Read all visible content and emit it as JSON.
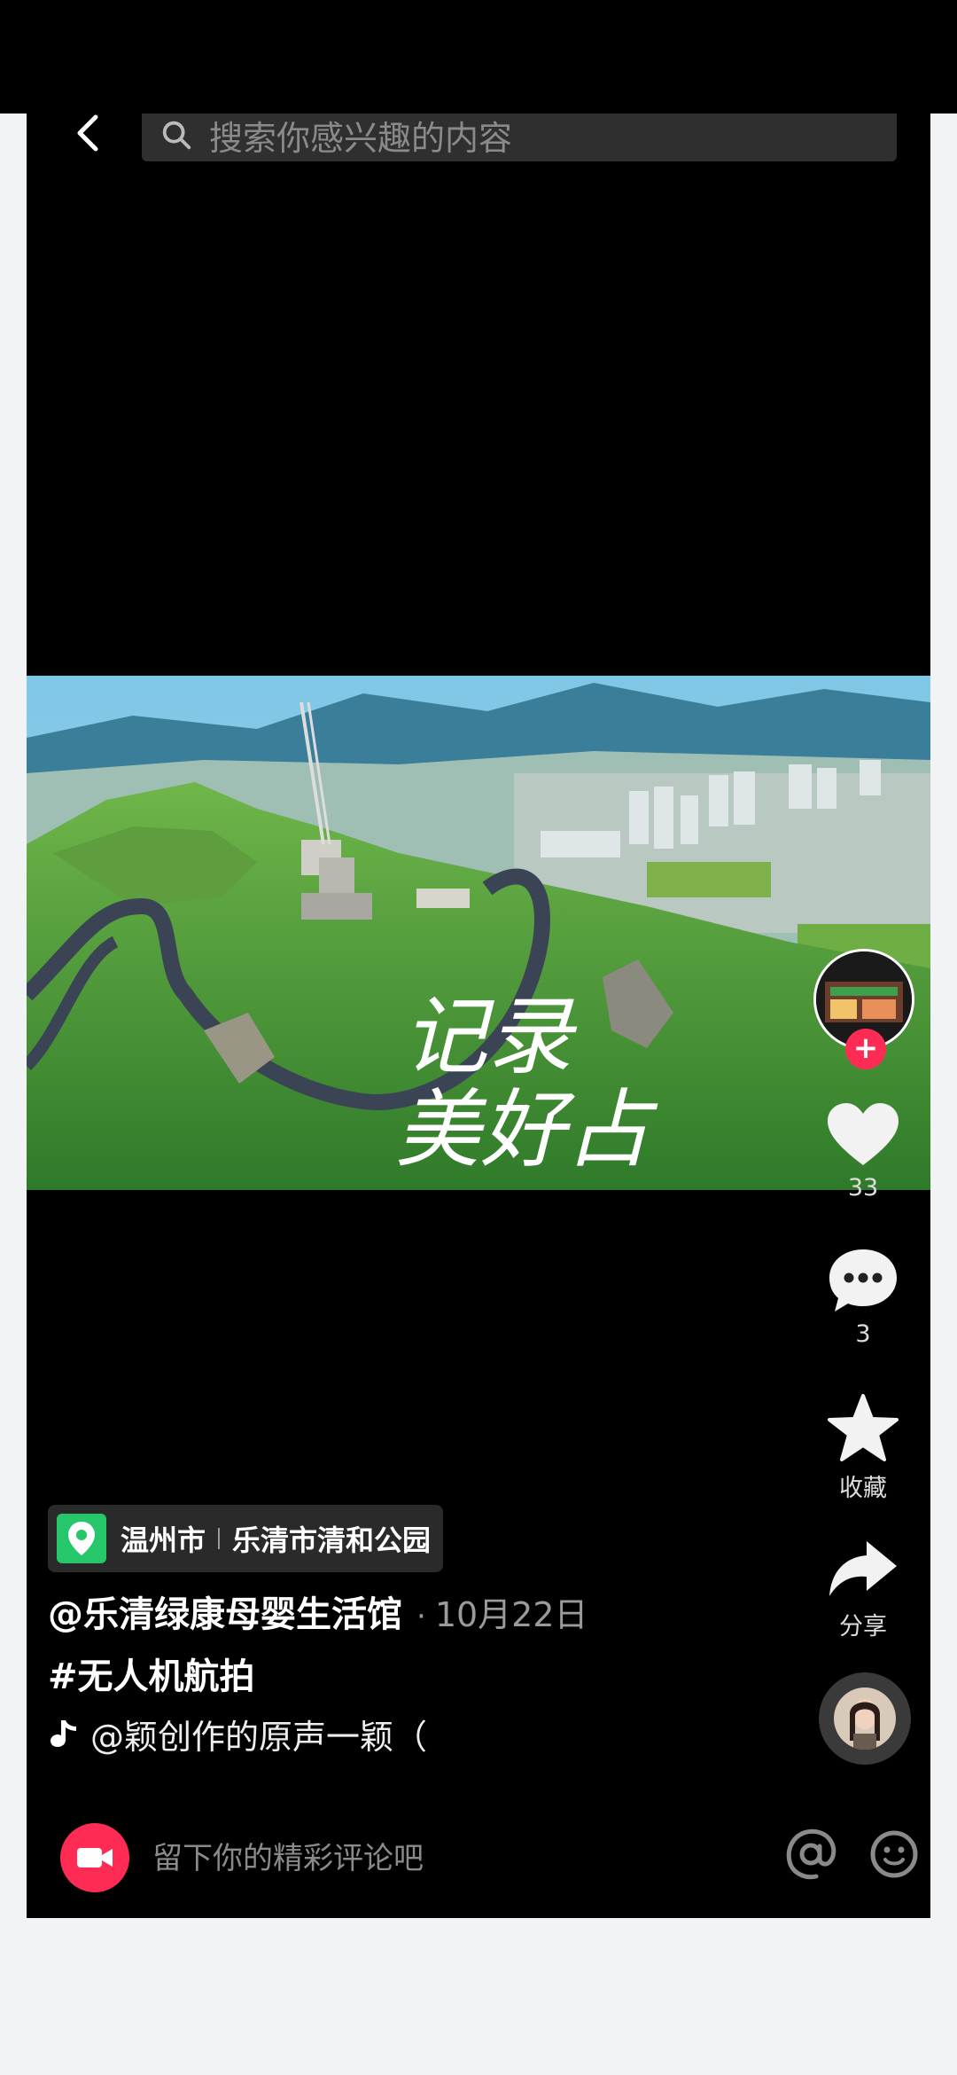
{
  "search": {
    "placeholder": "搜索你感兴趣的内容"
  },
  "video": {
    "overlay_text_line1": "记录",
    "overlay_text_line2": "美好占"
  },
  "rail": {
    "like_count": "33",
    "comment_count": "3",
    "favorite_label": "收藏",
    "share_label": "分享"
  },
  "location": {
    "city": "温州市",
    "place": "乐清市清和公园"
  },
  "post": {
    "author": "@乐清绿康母婴生活馆",
    "date_sep": "·",
    "date": "10月22日",
    "hashtag": "#无人机航拍",
    "music": "@颖创作的原声一颖（"
  },
  "comment_bar": {
    "placeholder": "留下你的精彩评论吧"
  },
  "colors": {
    "accent": "#fe2c55",
    "location_green": "#25c76a"
  }
}
